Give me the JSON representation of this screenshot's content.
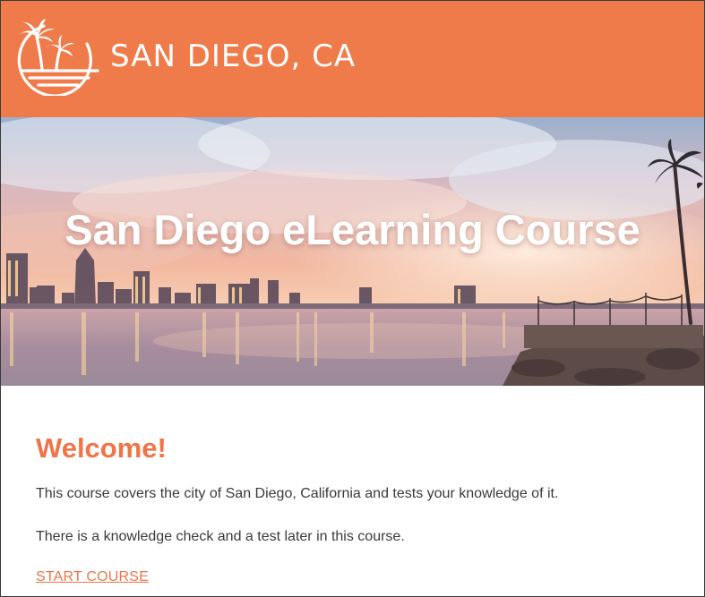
{
  "header": {
    "brand_title": "SAN DIEGO, CA",
    "logo_icon": "palm-tree-sunset-icon",
    "background_color": "#f07b4a"
  },
  "hero": {
    "title": "San Diego eLearning Course"
  },
  "main": {
    "heading": "Welcome!",
    "paragraphs": [
      "This course covers the city of San Diego, California and tests your knowledge of it.",
      "There is a knowledge check and a test later in this course."
    ],
    "start_link": "START COURSE",
    "accent_color": "#ee7548"
  }
}
